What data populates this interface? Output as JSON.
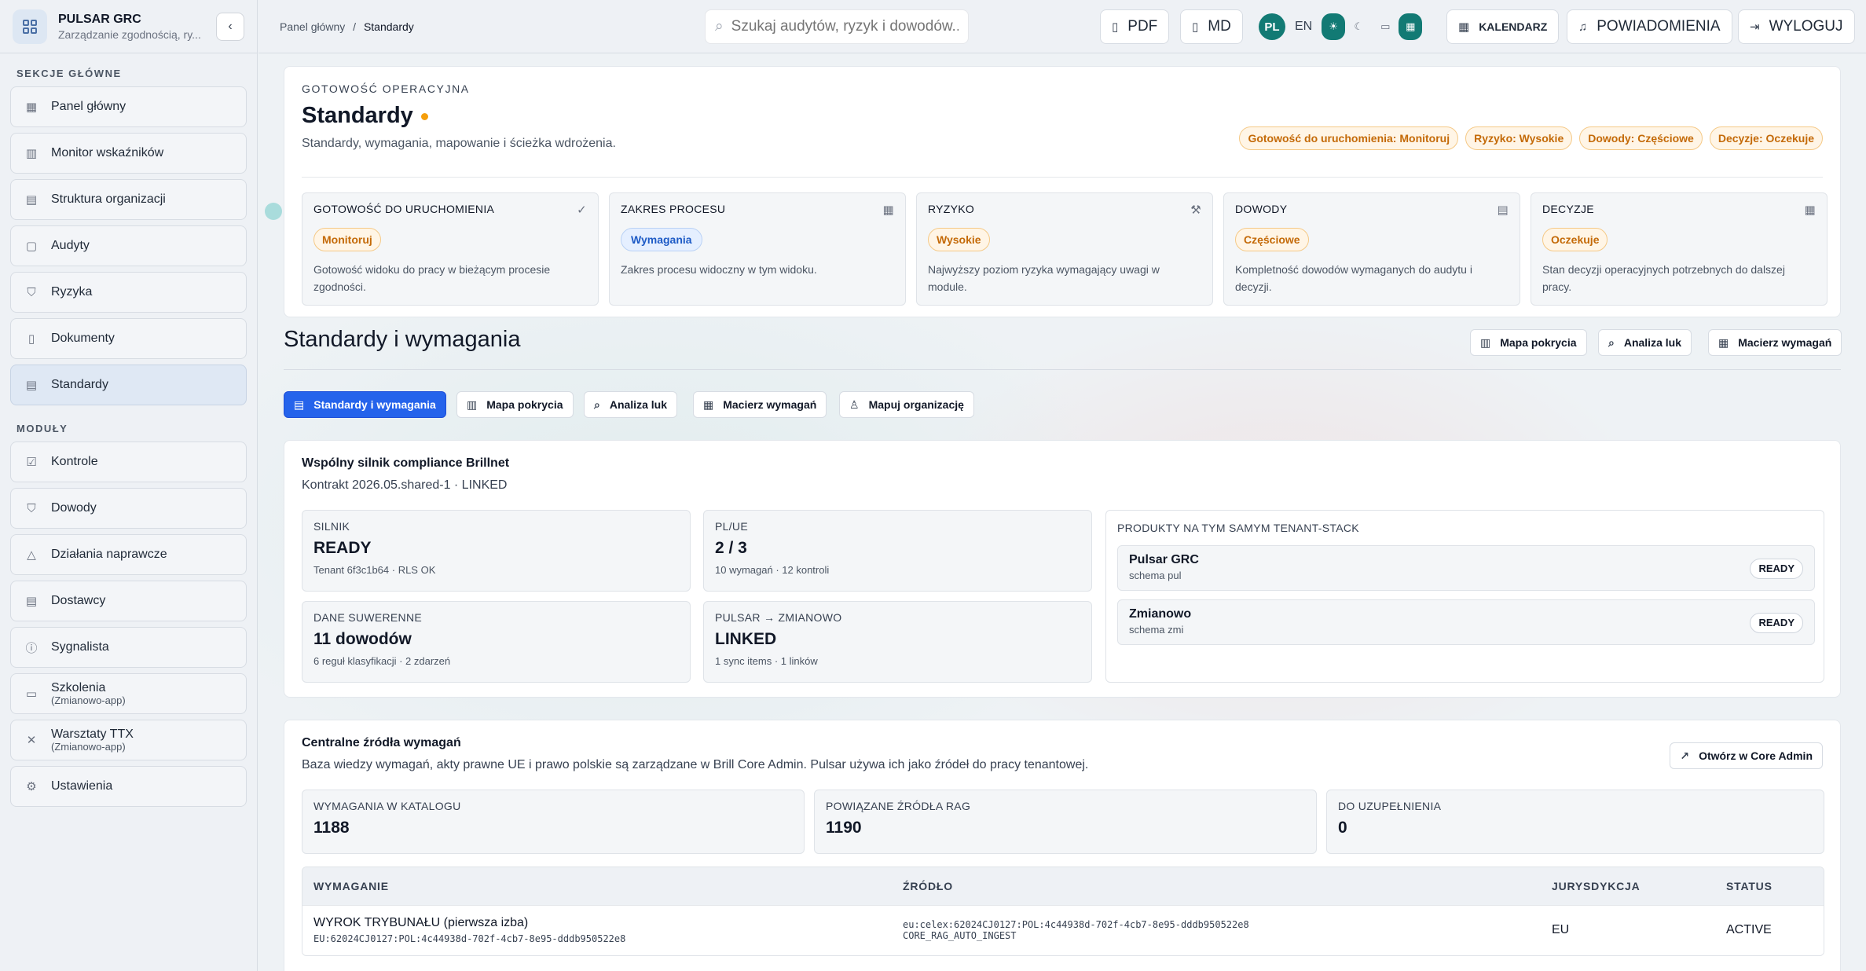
{
  "app": {
    "title": "PULSAR GRC",
    "subtitle": "Zarządzanie zgodnością, ry...",
    "collapse_icon": "chevron-left-icon"
  },
  "sidebar": {
    "main_section_label": "SEKCJE GŁÓWNE",
    "main_items": [
      {
        "label": "Panel główny",
        "icon": "grid-icon"
      },
      {
        "label": "Monitor wskaźników",
        "icon": "bar-chart-icon"
      },
      {
        "label": "Struktura organizacji",
        "icon": "building-icon"
      },
      {
        "label": "Audyty",
        "icon": "clipboard-icon"
      },
      {
        "label": "Ryzyka",
        "icon": "shield-icon"
      },
      {
        "label": "Dokumenty",
        "icon": "file-icon"
      },
      {
        "label": "Standardy",
        "icon": "file-text-icon",
        "active": true
      }
    ],
    "modules_section_label": "MODUŁY",
    "module_items": [
      {
        "label": "Kontrole",
        "icon": "check-square-icon"
      },
      {
        "label": "Dowody",
        "icon": "shield-check-icon"
      },
      {
        "label": "Działania naprawcze",
        "icon": "alert-triangle-icon"
      },
      {
        "label": "Dostawcy",
        "icon": "building-icon"
      },
      {
        "label": "Sygnalista",
        "icon": "info-icon"
      },
      {
        "label": "Szkolenia",
        "sublabel": "(Zmianowo-app)",
        "icon": "book-icon"
      },
      {
        "label": "Warsztaty TTX",
        "sublabel": "(Zmianowo-app)",
        "icon": "tools-icon"
      },
      {
        "label": "Ustawienia",
        "icon": "gear-icon"
      }
    ]
  },
  "topbar": {
    "breadcrumb": {
      "root": "Panel główny",
      "separator": "/",
      "current": "Standardy"
    },
    "search_placeholder": "Szukaj audytów, ryzyk i dowodów...",
    "pdf_label": "PDF",
    "md_label": "MD",
    "lang_pl": "PL",
    "lang_en": "EN",
    "calendar_label": "KALENDARZ",
    "notifications_label": "POWIADOMIENIA",
    "logout_label": "WYLOGUJ"
  },
  "hero": {
    "kicker": "GOTOWOŚĆ OPERACYJNA",
    "title": "Standardy",
    "description": "Standardy, wymagania, mapowanie i ścieżka wdrożenia.",
    "badges": [
      "Gotowość do uruchomienia: Monitoruj",
      "Ryzyko: Wysokie",
      "Dowody: Częściowe",
      "Decyzje: Oczekuje"
    ],
    "cards": [
      {
        "title": "GOTOWOŚĆ DO URUCHOMIENIA",
        "icon": "check-icon",
        "badge": "Monitoruj",
        "badge_style": "orange",
        "text": "Gotowość widoku do pracy w bieżącym procesie zgodności."
      },
      {
        "title": "ZAKRES PROCESU",
        "icon": "grid-icon",
        "badge": "Wymagania",
        "badge_style": "blue",
        "text": "Zakres procesu widoczny w tym widoku."
      },
      {
        "title": "RYZYKO",
        "icon": "hammer-icon",
        "badge": "Wysokie",
        "badge_style": "orange",
        "text": "Najwyższy poziom ryzyka wymagający uwagi w module."
      },
      {
        "title": "DOWODY",
        "icon": "archive-icon",
        "badge": "Częściowe",
        "badge_style": "orange",
        "text": "Kompletność dowodów wymaganych do audytu i decyzji."
      },
      {
        "title": "DECYZJE",
        "icon": "calendar-icon",
        "badge": "Oczekuje",
        "badge_style": "orange",
        "text": "Stan decyzji operacyjnych potrzebnych do dalszej pracy."
      }
    ]
  },
  "section": {
    "title": "Standardy i wymagania",
    "actions": [
      "Mapa pokrycia",
      "Analiza luk",
      "Macierz wymagań"
    ],
    "tabs": [
      {
        "label": "Standardy i wymagania",
        "icon": "file-text-icon",
        "active": true
      },
      {
        "label": "Mapa pokrycia",
        "icon": "bar-chart-icon"
      },
      {
        "label": "Analiza luk",
        "icon": "search-icon"
      },
      {
        "label": "Macierz wymagań",
        "icon": "grid-icon"
      },
      {
        "label": "Mapuj organizację",
        "icon": "users-icon"
      }
    ]
  },
  "engine": {
    "title": "Wspólny silnik compliance Brillnet",
    "contract": "Kontrakt 2026.05.shared-1 · LINKED",
    "tiles": [
      {
        "label": "SILNIK",
        "value": "READY",
        "sub": "Tenant 6f3c1b64 · RLS OK"
      },
      {
        "label": "PL/UE",
        "value": "2 / 3",
        "sub": "10 wymagań · 12 kontroli"
      },
      {
        "label": "DANE SUWERENNE",
        "value": "11 dowodów",
        "sub": "6 reguł klasyfikacji · 2 zdarzeń"
      },
      {
        "label": "PULSAR → ZMIANOWO",
        "value": "LINKED",
        "sub": "1 sync items · 1 linków"
      }
    ],
    "products_title": "PRODUKTY NA TYM SAMYM TENANT-STACK",
    "products": [
      {
        "name": "Pulsar GRC",
        "schema": "schema pul",
        "status": "READY"
      },
      {
        "name": "Zmianowo",
        "schema": "schema zmi",
        "status": "READY"
      }
    ]
  },
  "sources": {
    "title": "Centralne źródła wymagań",
    "description": "Baza wiedzy wymagań, akty prawne UE i prawo polskie są zarządzane w Brill Core Admin. Pulsar używa ich jako źródeł do pracy tenantowej.",
    "open_button": "Otwórz w Core Admin",
    "stats": [
      {
        "label": "WYMAGANIA W KATALOGU",
        "value": "1188"
      },
      {
        "label": "POWIĄZANE ŹRÓDŁA RAG",
        "value": "1190"
      },
      {
        "label": "DO UZUPEŁNIENIA",
        "value": "0"
      }
    ],
    "table": {
      "columns": [
        "WYMAGANIE",
        "ŹRÓDŁO",
        "JURYSDYKCJA",
        "STATUS"
      ],
      "rows": [
        {
          "title": "WYROK TRYBUNAŁU (pierwsza izba)",
          "code": "EU:62024CJ0127:POL:4c44938d-702f-4cb7-8e95-dddb950522e8",
          "source": "eu:celex:62024CJ0127:POL:4c44938d-702f-4cb7-8e95-dddb950522e8",
          "source_sub": "CORE_RAG_AUTO_INGEST",
          "jurisdiction": "EU",
          "status": "ACTIVE"
        }
      ]
    }
  }
}
